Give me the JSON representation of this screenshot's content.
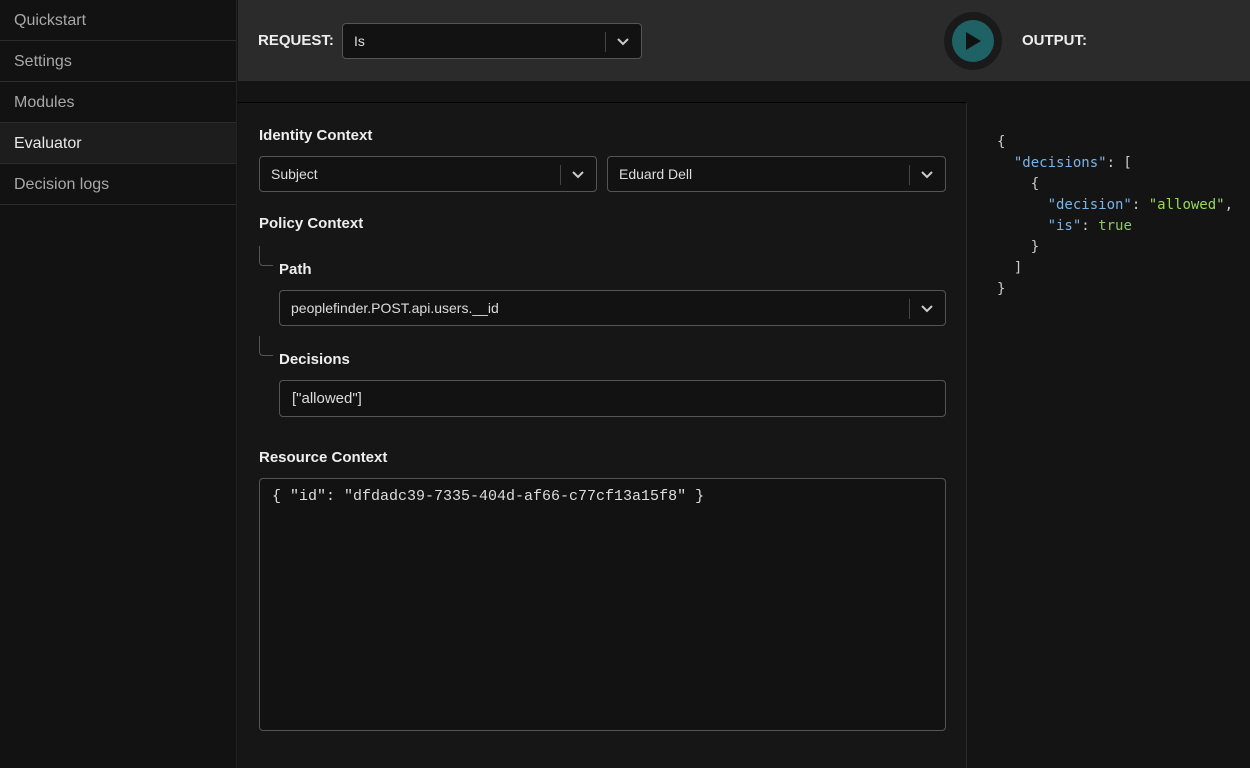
{
  "sidebar": {
    "items": [
      {
        "label": "Quickstart"
      },
      {
        "label": "Settings"
      },
      {
        "label": "Modules"
      },
      {
        "label": "Evaluator",
        "active": true
      },
      {
        "label": "Decision logs"
      }
    ]
  },
  "header": {
    "request_label": "REQUEST:",
    "request_value": "Is",
    "output_label": "OUTPUT:",
    "run_icon": "play-icon",
    "accent": "#1f6266"
  },
  "identity": {
    "title": "Identity Context",
    "type": "Subject",
    "user": "Eduard Dell"
  },
  "policy": {
    "title": "Policy Context",
    "path_label": "Path",
    "path_value": "peoplefinder.POST.api.users.__id",
    "decisions_label": "Decisions",
    "decisions_value": "[\"allowed\"]"
  },
  "resource": {
    "title": "Resource Context",
    "value": "{ \"id\": \"dfdadc39-7335-404d-af66-c77cf13a15f8\" }"
  },
  "output": {
    "open": "{",
    "key_decisions": "\"decisions\"",
    "colon_bracket": ": [",
    "obj_open": "{",
    "key_decision": "\"decision\"",
    "val_decision": "\"allowed\"",
    "key_is": "\"is\"",
    "val_is": "true",
    "obj_close": "}",
    "arr_close": "]",
    "close": "}"
  }
}
